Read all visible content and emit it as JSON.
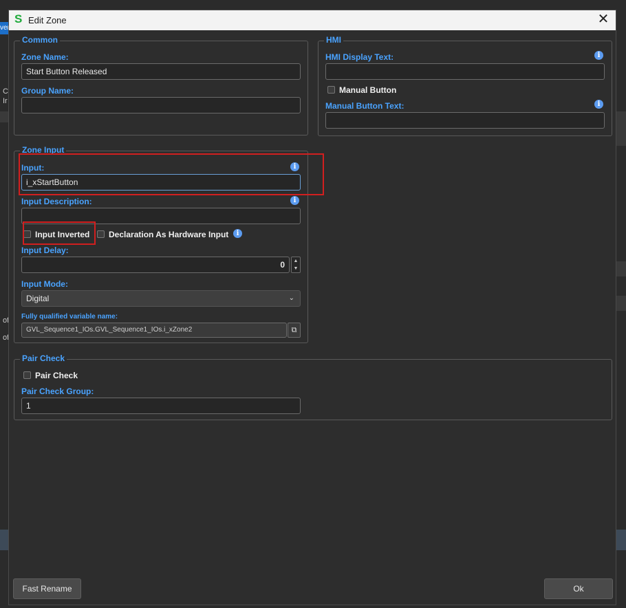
{
  "window": {
    "title": "Edit Zone",
    "logo": "S",
    "close_glyph": "✕"
  },
  "background": {
    "tab_fragment": "ver",
    "frag1": "C",
    "frag2": "Ir",
    "frag3": "of",
    "frag4": "of"
  },
  "common": {
    "legend": "Common",
    "zone_name_label": "Zone Name:",
    "zone_name_value": "Start Button Released",
    "group_name_label": "Group Name:",
    "group_name_value": ""
  },
  "hmi": {
    "legend": "HMI",
    "display_text_label": "HMI Display Text:",
    "display_text_value": "",
    "manual_button_label": "Manual Button",
    "manual_button_text_label": "Manual Button Text:",
    "manual_button_text_value": ""
  },
  "zone_input": {
    "legend": "Zone Input",
    "input_label": "Input:",
    "input_value": "i_xStartButton",
    "description_label": "Input Description:",
    "description_value": "",
    "inverted_label": "Input Inverted",
    "hardware_label": "Declaration As Hardware Input",
    "delay_label": "Input Delay:",
    "delay_value": "0",
    "mode_label": "Input Mode:",
    "mode_value": "Digital",
    "fqn_label": "Fully qualified variable name:",
    "fqn_value": "GVL_Sequence1_IOs.GVL_Sequence1_IOs.i_xZone2"
  },
  "pair_check": {
    "legend": "Pair Check",
    "check_label": "Pair Check",
    "group_label": "Pair Check Group:",
    "group_value": "1"
  },
  "buttons": {
    "fast_rename": "Fast Rename",
    "ok": "Ok"
  },
  "icons": {
    "info": "i",
    "spin_up": "▲",
    "spin_down": "▼",
    "dropdown": "⌄",
    "copy": "⧉"
  },
  "colors": {
    "accent_label": "#4aa3ff",
    "highlight": "#d21f1f",
    "brand": "#1faa3b"
  }
}
